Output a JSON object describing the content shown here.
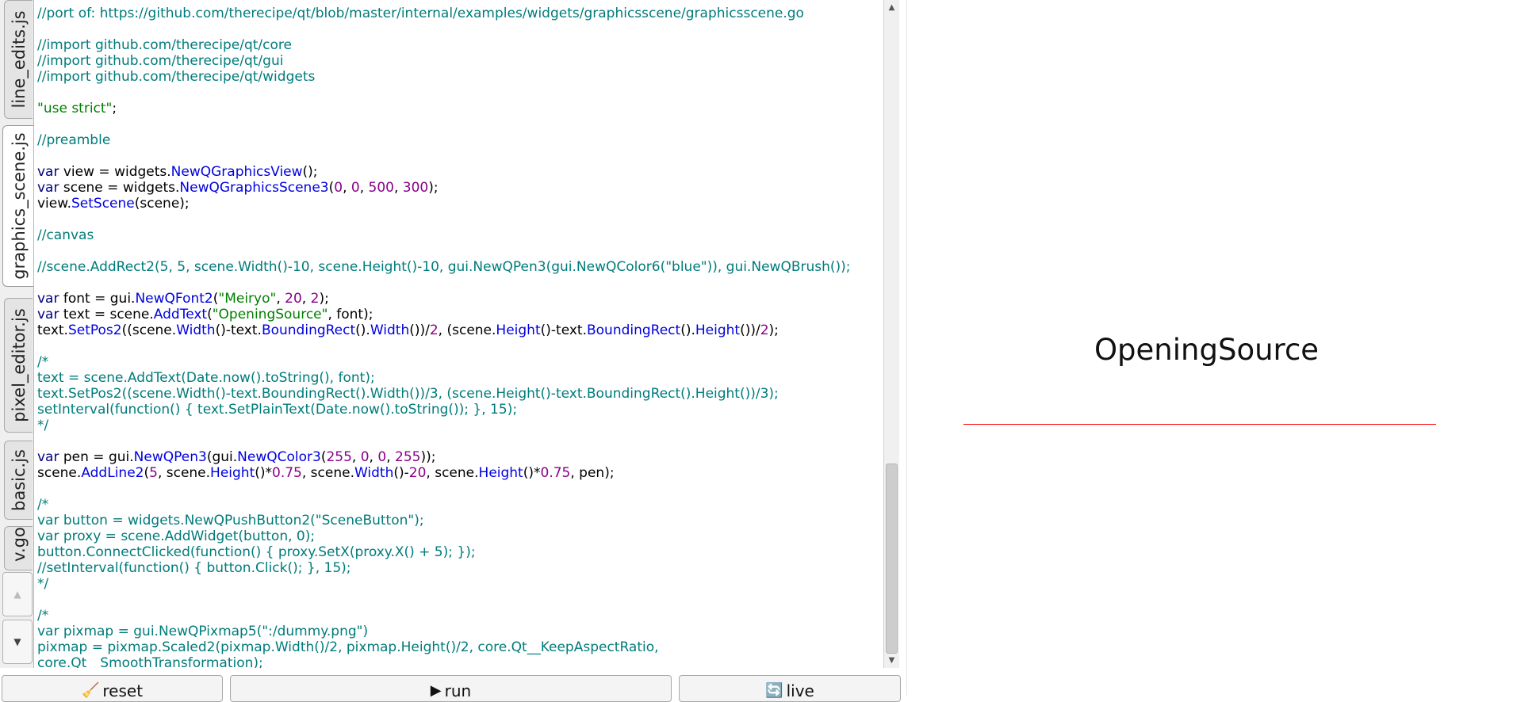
{
  "tabs": [
    {
      "label": "line_edits.js",
      "active": false
    },
    {
      "label": "graphics_scene.js",
      "active": true
    },
    {
      "label": "pixel_editor.js",
      "active": false
    },
    {
      "label": "basic.js",
      "active": false
    },
    {
      "label": "v.go",
      "active": false
    }
  ],
  "editor": {
    "lines": [
      [
        [
          "c",
          "//port of: https://github.com/therecipe/qt/blob/master/internal/examples/widgets/graphicsscene/graphicsscene.go"
        ]
      ],
      [],
      [
        [
          "c",
          "//import github.com/therecipe/qt/core"
        ]
      ],
      [
        [
          "c",
          "//import github.com/therecipe/qt/gui"
        ]
      ],
      [
        [
          "c",
          "//import github.com/therecipe/qt/widgets"
        ]
      ],
      [],
      [
        [
          "s",
          "\"use strict\""
        ],
        [
          "p",
          ";"
        ]
      ],
      [],
      [
        [
          "c",
          "//preamble"
        ]
      ],
      [],
      [
        [
          "k",
          "var"
        ],
        [
          "p",
          " view = widgets."
        ],
        [
          "f",
          "NewQGraphicsView"
        ],
        [
          "p",
          "();"
        ]
      ],
      [
        [
          "k",
          "var"
        ],
        [
          "p",
          " scene = widgets."
        ],
        [
          "f",
          "NewQGraphicsScene3"
        ],
        [
          "p",
          "("
        ],
        [
          "n",
          "0"
        ],
        [
          "p",
          ", "
        ],
        [
          "n",
          "0"
        ],
        [
          "p",
          ", "
        ],
        [
          "n",
          "500"
        ],
        [
          "p",
          ", "
        ],
        [
          "n",
          "300"
        ],
        [
          "p",
          ");"
        ]
      ],
      [
        [
          "p",
          "view."
        ],
        [
          "f",
          "SetScene"
        ],
        [
          "p",
          "(scene);"
        ]
      ],
      [],
      [
        [
          "c",
          "//canvas"
        ]
      ],
      [],
      [
        [
          "c",
          "//scene.AddRect2(5, 5, scene.Width()-10, scene.Height()-10, gui.NewQPen3(gui.NewQColor6(\"blue\")), gui.NewQBrush());"
        ]
      ],
      [],
      [
        [
          "k",
          "var"
        ],
        [
          "p",
          " font = gui."
        ],
        [
          "f",
          "NewQFont2"
        ],
        [
          "p",
          "("
        ],
        [
          "s",
          "\"Meiryo\""
        ],
        [
          "p",
          ", "
        ],
        [
          "n",
          "20"
        ],
        [
          "p",
          ", "
        ],
        [
          "n",
          "2"
        ],
        [
          "p",
          ");"
        ]
      ],
      [
        [
          "k",
          "var"
        ],
        [
          "p",
          " text = scene."
        ],
        [
          "f",
          "AddText"
        ],
        [
          "p",
          "("
        ],
        [
          "s",
          "\"OpeningSource\""
        ],
        [
          "p",
          ", font);"
        ]
      ],
      [
        [
          "p",
          "text."
        ],
        [
          "f",
          "SetPos2"
        ],
        [
          "p",
          "((scene."
        ],
        [
          "f",
          "Width"
        ],
        [
          "p",
          "()-text."
        ],
        [
          "f",
          "BoundingRect"
        ],
        [
          "p",
          "()."
        ],
        [
          "f",
          "Width"
        ],
        [
          "p",
          "())/"
        ],
        [
          "n",
          "2"
        ],
        [
          "p",
          ", (scene."
        ],
        [
          "f",
          "Height"
        ],
        [
          "p",
          "()-text."
        ],
        [
          "f",
          "BoundingRect"
        ],
        [
          "p",
          "()."
        ],
        [
          "f",
          "Height"
        ],
        [
          "p",
          "())/"
        ],
        [
          "n",
          "2"
        ],
        [
          "p",
          ");"
        ]
      ],
      [],
      [
        [
          "c",
          "/*"
        ]
      ],
      [
        [
          "c",
          "text = scene.AddText(Date.now().toString(), font);"
        ]
      ],
      [
        [
          "c",
          "text.SetPos2((scene.Width()-text.BoundingRect().Width())/3, (scene.Height()-text.BoundingRect().Height())/3);"
        ]
      ],
      [
        [
          "c",
          "setInterval(function() { text.SetPlainText(Date.now().toString()); }, 15);"
        ]
      ],
      [
        [
          "c",
          "*/"
        ]
      ],
      [],
      [
        [
          "k",
          "var"
        ],
        [
          "p",
          " pen = gui."
        ],
        [
          "f",
          "NewQPen3"
        ],
        [
          "p",
          "(gui."
        ],
        [
          "f",
          "NewQColor3"
        ],
        [
          "p",
          "("
        ],
        [
          "n",
          "255"
        ],
        [
          "p",
          ", "
        ],
        [
          "n",
          "0"
        ],
        [
          "p",
          ", "
        ],
        [
          "n",
          "0"
        ],
        [
          "p",
          ", "
        ],
        [
          "n",
          "255"
        ],
        [
          "p",
          "));"
        ]
      ],
      [
        [
          "p",
          "scene."
        ],
        [
          "f",
          "AddLine2"
        ],
        [
          "p",
          "("
        ],
        [
          "n",
          "5"
        ],
        [
          "p",
          ", scene."
        ],
        [
          "f",
          "Height"
        ],
        [
          "p",
          "()*"
        ],
        [
          "n",
          "0.75"
        ],
        [
          "p",
          ", scene."
        ],
        [
          "f",
          "Width"
        ],
        [
          "p",
          "()-"
        ],
        [
          "n",
          "20"
        ],
        [
          "p",
          ", scene."
        ],
        [
          "f",
          "Height"
        ],
        [
          "p",
          "()*"
        ],
        [
          "n",
          "0.75"
        ],
        [
          "p",
          ", pen);"
        ]
      ],
      [],
      [
        [
          "c",
          "/*"
        ]
      ],
      [
        [
          "c",
          "var button = widgets.NewQPushButton2(\"SceneButton\");"
        ]
      ],
      [
        [
          "c",
          "var proxy = scene.AddWidget(button, 0);"
        ]
      ],
      [
        [
          "c",
          "button.ConnectClicked(function() { proxy.SetX(proxy.X() + 5); });"
        ]
      ],
      [
        [
          "c",
          "//setInterval(function() { button.Click(); }, 15);"
        ]
      ],
      [
        [
          "c",
          "*/"
        ]
      ],
      [],
      [
        [
          "c",
          "/*"
        ]
      ],
      [
        [
          "c",
          "var pixmap = gui.NewQPixmap5(\":/dummy.png\")"
        ]
      ],
      [
        [
          "c",
          "pixmap = pixmap.Scaled2(pixmap.Width()/2, pixmap.Height()/2, core.Qt__KeepAspectRatio,"
        ]
      ],
      [
        [
          "c",
          "core.Qt__SmoothTransformation);"
        ]
      ]
    ]
  },
  "preview": {
    "scene_text": "OpeningSource",
    "line_color": "#ff0000"
  },
  "buttons": {
    "reset": {
      "label": "reset",
      "icon": "broom-icon"
    },
    "run": {
      "label": "run",
      "icon": "play-icon"
    },
    "live": {
      "label": "live",
      "icon": "refresh-icon"
    }
  },
  "colors": {
    "comment": "#007b7b",
    "keyword": "#00007f",
    "function": "#0000e0",
    "number": "#8a008a",
    "string": "#008000"
  }
}
